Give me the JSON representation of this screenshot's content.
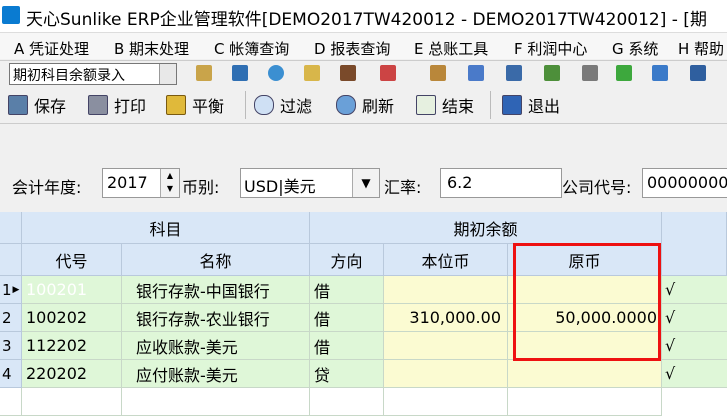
{
  "window": {
    "title": "天心Sunlike ERP企业管理软件[DEMO2017TW420012 - DEMO2017TW420012] - [期"
  },
  "menu": [
    "A 凭证处理",
    "B 期末处理",
    "C 帐簿查询",
    "D 报表查询",
    "E 总账工具",
    "F 利润中心",
    "G 系统",
    "H 帮助"
  ],
  "window_select": {
    "value": "期初科目余额录入"
  },
  "toolbar": {
    "save": "保存",
    "print": "打印",
    "balance": "平衡",
    "filter": "过滤",
    "refresh": "刷新",
    "finish": "结束",
    "exit": "退出"
  },
  "filter": {
    "year_label": "会计年度:",
    "year": "2017",
    "currency_label": "币别:",
    "currency": "USD|美元",
    "rate_label": "汇率:",
    "rate": "6.2",
    "company_label": "公司代号:",
    "company": "00000000"
  },
  "grid": {
    "group_subject": "科目",
    "group_opening": "期初余额",
    "col_code": "代号",
    "col_name": "名称",
    "col_direction": "方向",
    "col_local": "本位币",
    "col_foreign": "原币",
    "rows": [
      {
        "num": "1",
        "code": "100201",
        "name": "银行存款-中国银行",
        "direction": "借",
        "local": "",
        "foreign": "",
        "check": "√"
      },
      {
        "num": "2",
        "code": "100202",
        "name": "银行存款-农业银行",
        "direction": "借",
        "local": "310,000.00",
        "foreign": "50,000.0000",
        "check": "√"
      },
      {
        "num": "3",
        "code": "112202",
        "name": "应收账款-美元",
        "direction": "借",
        "local": "",
        "foreign": "",
        "check": "√"
      },
      {
        "num": "4",
        "code": "220202",
        "name": "应付账款-美元",
        "direction": "贷",
        "local": "",
        "foreign": "",
        "check": "√"
      }
    ]
  },
  "colors": {
    "green": "#dff7d8",
    "yellow": "#fbfbd2",
    "header": "#d9e7f7",
    "highlight": "#e11111"
  }
}
